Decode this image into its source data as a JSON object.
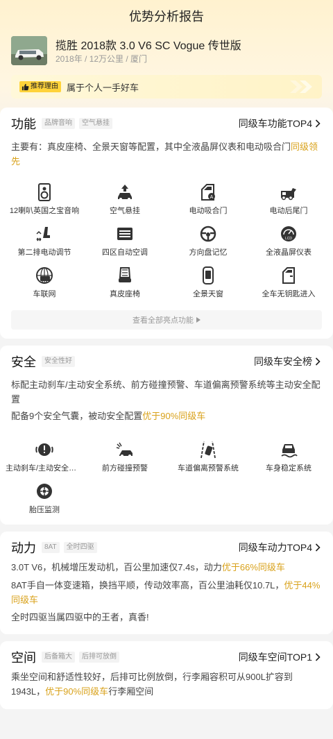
{
  "header": {
    "title": "优势分析报告"
  },
  "car": {
    "name": "揽胜 2018款 3.0 V6 SC Vogue 传世版",
    "meta": "2018年 / 12万公里 / 厦门",
    "thumb_icon": "car-photo"
  },
  "reason": {
    "badge": "推荐理由",
    "text": "属于个人一手好车"
  },
  "function": {
    "title": "功能",
    "tags": [
      "品牌音响",
      "空气悬挂"
    ],
    "link": "同级车功能TOP4",
    "desc_pre": "主要有：真皮座椅、全景天窗等配置，其中全液晶屏仪表和电动吸合门",
    "desc_hl": "同级领先",
    "items": [
      {
        "label": "12喇叭英国之宝音响",
        "icon": "speaker-icon"
      },
      {
        "label": "空气悬挂",
        "icon": "air-suspension-icon"
      },
      {
        "label": "电动吸合门",
        "icon": "soft-close-door-icon"
      },
      {
        "label": "电动后尾门",
        "icon": "power-tailgate-icon"
      },
      {
        "label": "第二排电动调节",
        "icon": "power-seat-icon"
      },
      {
        "label": "四区自动空调",
        "icon": "climate-control-icon"
      },
      {
        "label": "方向盘记忆",
        "icon": "steering-memory-icon"
      },
      {
        "label": "全液晶屏仪表",
        "icon": "lcd-gauge-icon"
      },
      {
        "label": "车联网",
        "icon": "connected-car-icon"
      },
      {
        "label": "真皮座椅",
        "icon": "leather-seat-icon"
      },
      {
        "label": "全景天窗",
        "icon": "panoramic-roof-icon"
      },
      {
        "label": "全车无钥匙进入",
        "icon": "keyless-entry-icon"
      }
    ],
    "view_all": "查看全部亮点功能"
  },
  "safety": {
    "title": "安全",
    "tags": [
      "安全性好"
    ],
    "link": "同级车安全榜",
    "desc1": "标配主动刹车/主动安全系统、前方碰撞预警、车道偏离预警系统等主动安全配置",
    "desc2_pre": "配备9个安全气囊，被动安全配置",
    "desc2_hl": "优于90%同级车",
    "items": [
      {
        "label": "主动刹车/主动安全系统",
        "icon": "brake-warning-icon"
      },
      {
        "label": "前方碰撞预警",
        "icon": "collision-warning-icon"
      },
      {
        "label": "车道偏离预警系统",
        "icon": "lane-departure-icon"
      },
      {
        "label": "车身稳定系统",
        "icon": "stability-icon"
      },
      {
        "label": "胎压监测",
        "icon": "tire-pressure-icon"
      }
    ]
  },
  "power": {
    "title": "动力",
    "tags": [
      "8AT",
      "全时四驱"
    ],
    "link": "同级车动力TOP4",
    "l1_pre": "3.0T V6，机械增压发动机，百公里加速仅7.4s，动力",
    "l1_hl": "优于66%同级车",
    "l2_pre": "8AT手自一体变速箱，换挡平顺，传动效率高，百公里油耗仅10.7L，",
    "l2_hl": "优于44%同级车",
    "l3": "全时四驱当属四驱中的王者，真香!"
  },
  "space": {
    "title": "空间",
    "tags": [
      "后备箱大",
      "后排可放倒"
    ],
    "link": "同级车空间TOP1",
    "pre": "乘坐空间和舒适性较好，后排可比例放倒，行李厢容积可从900L扩容到1943L，",
    "hl": "优于90%同级车",
    "post": "行李厢空间"
  },
  "colors": {
    "accent": "#d9a21b",
    "badge": "#ffd33a",
    "hero": "#fff2cf"
  }
}
